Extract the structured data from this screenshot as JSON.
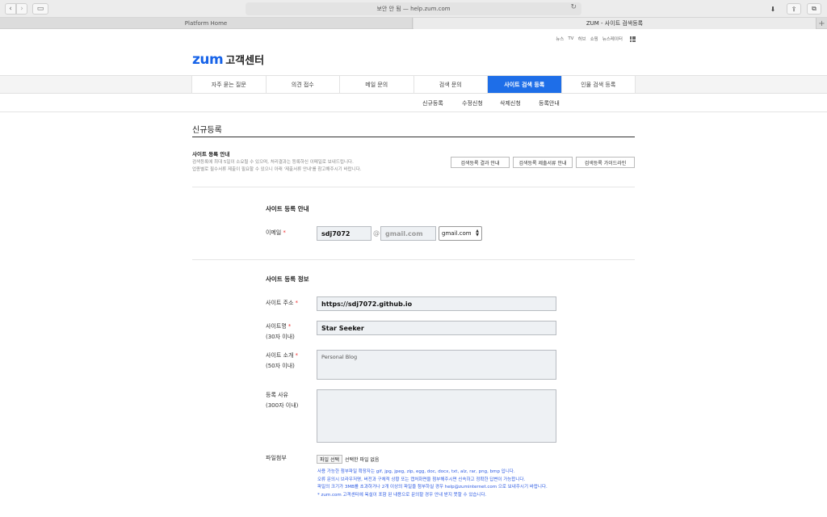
{
  "browser": {
    "address": "보안 안 됨 — help.zum.com",
    "tabs": [
      "Platform Home",
      "ZUM - 사이트 검색등록"
    ]
  },
  "header": {
    "util_links": [
      "뉴스",
      "TV",
      "허브",
      "쇼핑",
      "뉴스레이터"
    ],
    "logo_brand": "zum",
    "logo_text": "고객센터"
  },
  "gnb": [
    "자주 묻는 질문",
    "의견 접수",
    "메일 문의",
    "검색 문의",
    "사이트 검색 등록",
    "인물 검색 등록"
  ],
  "lnb": [
    "신규등록",
    "수정신청",
    "삭제신청",
    "등록안내"
  ],
  "page_title": "신규등록",
  "guide": {
    "heading": "사이트 등록 안내",
    "desc_line1": "검색등록에 최대 5일이 소요될 수 있으며, 처리결과는 등록하신 이메일로 보내드립니다.",
    "desc_line2": "업종별로 필수서류 제출이 필요할 수 있으니 아래 '제출서류 안내'를 참고해주시기 바랍니다.",
    "buttons": [
      "검색등록 결과 안내",
      "검색등록 제출서류 안내",
      "검색등록 가이드라인"
    ]
  },
  "section1": {
    "title": "사이트 등록 안내",
    "email_label": "이메일",
    "email_id": "sdj7072",
    "at": "@",
    "email_domain": "gmail.com",
    "domain_select": "gmail.com"
  },
  "section2": {
    "title": "사이트 등록 정보",
    "url_label": "사이트 주소",
    "url_value": "https://sdj7072.github.io",
    "name_label": "사이트명",
    "name_hint": "(30자 이내)",
    "name_value": "Star Seeker",
    "intro_label": "사이트 소개",
    "intro_hint": "(50자 이내)",
    "intro_value": "Personal Blog",
    "reason_label": "등록 사유",
    "reason_hint": "(300자 이내)",
    "reason_value": "",
    "file_label": "파일첨부",
    "file_button": "파일 선택",
    "file_status": "선택한 파일 없음",
    "notes": [
      "사용 가능한 첨부파일 확장자는 gif, jpg, jpeg, zip, egg, doc, docx, txt, alz, rar, png, bmp 입니다.",
      "오류 문의시 브라우저명, 버전과 구체적 상황 또는 캡처화면을 첨부해주시면 신속하고 정확한 답변이 가능합니다.",
      "파일의 크기가 3MB를 초과하거나 2개 이상의 파일을 첨부하실 경우 help@zuminternet.com 으로 보내주시기 바랍니다.",
      "* zum.com 고객센터에 욕설이 포함 된 내용으로 문의할 경우 안내 받지 못할 수 있습니다."
    ]
  },
  "colors": {
    "accent": "#1e6ee8",
    "required": "#e33333",
    "note": "#2d5be3"
  }
}
